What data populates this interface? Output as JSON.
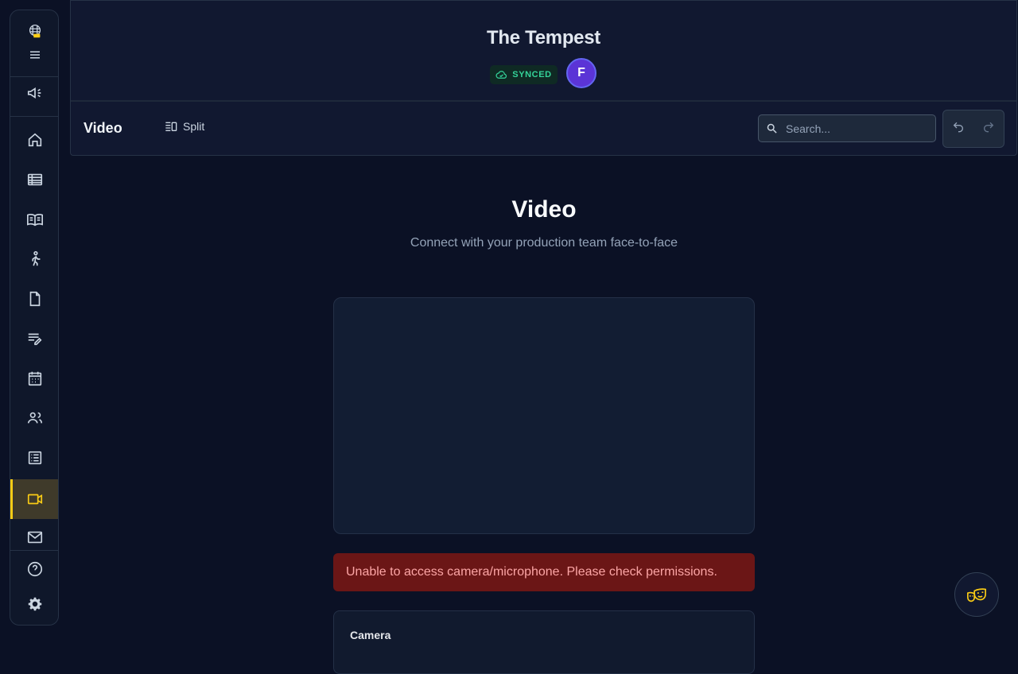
{
  "app": {
    "project_title": "The Tempest",
    "sync_status": "SYNCED",
    "user_initial": "F"
  },
  "sidebar": {
    "items": [
      {
        "icon": "logo-icon"
      },
      {
        "icon": "menu-icon"
      },
      {
        "icon": "megaphone-icon"
      },
      {
        "icon": "home-icon"
      },
      {
        "icon": "table-icon"
      },
      {
        "icon": "book-icon"
      },
      {
        "icon": "walking-person-icon"
      },
      {
        "icon": "document-icon"
      },
      {
        "icon": "notes-edit-icon"
      },
      {
        "icon": "calendar-icon"
      },
      {
        "icon": "people-icon"
      },
      {
        "icon": "list-icon"
      },
      {
        "icon": "video-icon",
        "active": true
      },
      {
        "icon": "mail-icon"
      },
      {
        "icon": "help-icon"
      },
      {
        "icon": "settings-icon"
      }
    ]
  },
  "toolbar": {
    "page_label": "Video",
    "split_label": "Split",
    "search_placeholder": "Search...",
    "undo_icon": "undo-icon",
    "redo_icon": "redo-icon"
  },
  "main": {
    "title": "Video",
    "subtitle": "Connect with your production team face-to-face",
    "error_message": "Unable to access camera/microphone. Please check permissions.",
    "camera_label": "Camera"
  },
  "colors": {
    "accent": "#facc15",
    "synced": "#34d399",
    "avatar": "#5b34d6",
    "error_bg": "#6b1616",
    "error_text": "#fca5a5"
  }
}
